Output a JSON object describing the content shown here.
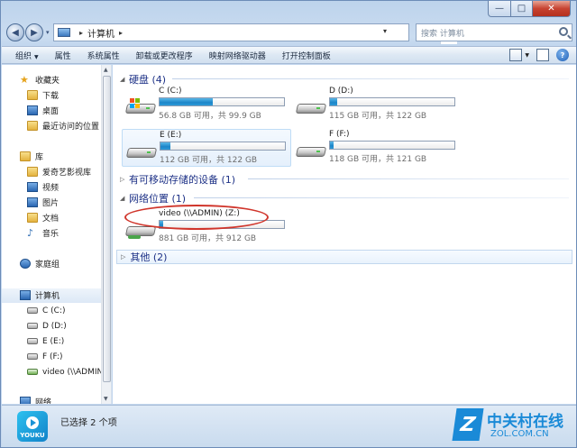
{
  "window": {
    "min_label": "—",
    "max_label": "□",
    "close_label": "✕"
  },
  "nav": {
    "back_label": "◀",
    "forward_label": "▶",
    "dropdown_label": "▾",
    "breadcrumb_sep": "▸",
    "breadcrumb": "计算机",
    "breadcrumb_end": "▸",
    "refresh_label": "↻",
    "search_placeholder": "搜索 计算机"
  },
  "toolbar": {
    "items": [
      "组织",
      "属性",
      "系统属性",
      "卸载或更改程序",
      "映射网络驱动器",
      "打开控制面板"
    ],
    "organize_dropdown": "▼",
    "view_dropdown": "▼",
    "help_label": "?"
  },
  "sidebar": {
    "favorites": {
      "label": "收藏夹",
      "items": [
        "下载",
        "桌面",
        "最近访问的位置"
      ]
    },
    "libraries": {
      "label": "库",
      "items": [
        "爱奇艺影视库",
        "视频",
        "图片",
        "文档",
        "音乐"
      ]
    },
    "homegroup": "家庭组",
    "computer": {
      "label": "计算机",
      "items": [
        "C (C:)",
        "D (D:)",
        "E (E:)",
        "F (F:)",
        "video (\\\\ADMIN"
      ]
    },
    "network": "网络"
  },
  "groups": {
    "hdd": {
      "label": "硬盘 (4)"
    },
    "removable": {
      "label": "有可移动存储的设备 (1)"
    },
    "network": {
      "label": "网络位置 (1)"
    },
    "other": {
      "label": "其他 (2)"
    }
  },
  "drives": [
    {
      "name": "C (C:)",
      "info": "56.8 GB 可用，共 99.9 GB",
      "used_fraction": 0.43
    },
    {
      "name": "D (D:)",
      "info": "115 GB 可用，共 122 GB",
      "used_fraction": 0.06
    },
    {
      "name": "E (E:)",
      "info": "112 GB 可用，共 122 GB",
      "used_fraction": 0.08
    },
    {
      "name": "F (F:)",
      "info": "118 GB 可用，共 121 GB",
      "used_fraction": 0.03
    }
  ],
  "network_drive": {
    "name": "video (\\\\ADMIN) (Z:)",
    "info": "881 GB 可用，共 912 GB",
    "used_fraction": 0.03
  },
  "status": {
    "text": "已选择 2 个项",
    "app_badge": "YOUKU"
  },
  "watermark": {
    "cn": "中关村在线",
    "en": "ZOL.COM.CN",
    "logo": "Z"
  },
  "colors": {
    "accent": "#1e3287",
    "bar_fill": "#2d9bd8",
    "annotation": "#d0352b"
  }
}
